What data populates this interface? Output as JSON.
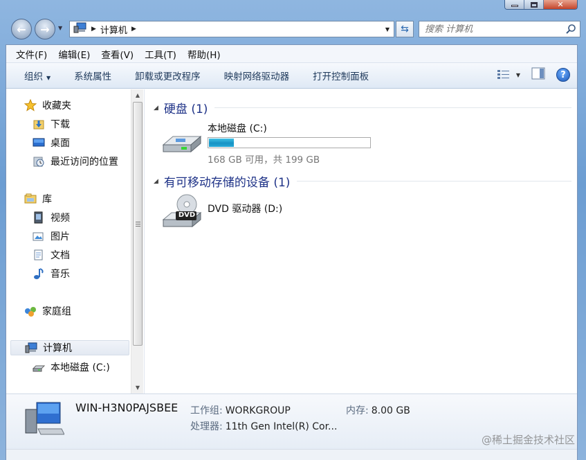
{
  "address": {
    "crumb": "计算机"
  },
  "search": {
    "placeholder": "搜索 计算机"
  },
  "menu": [
    "文件(F)",
    "编辑(E)",
    "查看(V)",
    "工具(T)",
    "帮助(H)"
  ],
  "commands": {
    "organize": "组织",
    "system_properties": "系统属性",
    "uninstall": "卸载或更改程序",
    "map_drive": "映射网络驱动器",
    "control_panel": "打开控制面板"
  },
  "nav": {
    "favorites": "收藏夹",
    "downloads": "下载",
    "desktop": "桌面",
    "recent": "最近访问的位置",
    "libraries": "库",
    "videos": "视频",
    "pictures": "图片",
    "documents": "文档",
    "music": "音乐",
    "homegroup": "家庭组",
    "computer": "计算机",
    "local_disk": "本地磁盘 (C:)"
  },
  "groups": {
    "hard_disks": "硬盘 (1)",
    "removable": "有可移动存储的设备 (1)"
  },
  "drives": {
    "c_name": "本地磁盘 (C:)",
    "c_capacity": "168 GB 可用，共 199 GB",
    "c_used_fraction": 0.156,
    "dvd_name": "DVD 驱动器 (D:)",
    "dvd_label": "DVD"
  },
  "details": {
    "computer_name": "WIN-H3N0PAJSBEE",
    "workgroup_label": "工作组:",
    "workgroup_value": "WORKGROUP",
    "memory_label": "内存:",
    "memory_value": "8.00 GB",
    "processor_label": "处理器:",
    "processor_value": "11th Gen Intel(R) Cor..."
  },
  "watermark": "@稀土掘金技术社区",
  "colors": {
    "accent": "#1e3287",
    "capacity_fill": "#1792c4"
  }
}
